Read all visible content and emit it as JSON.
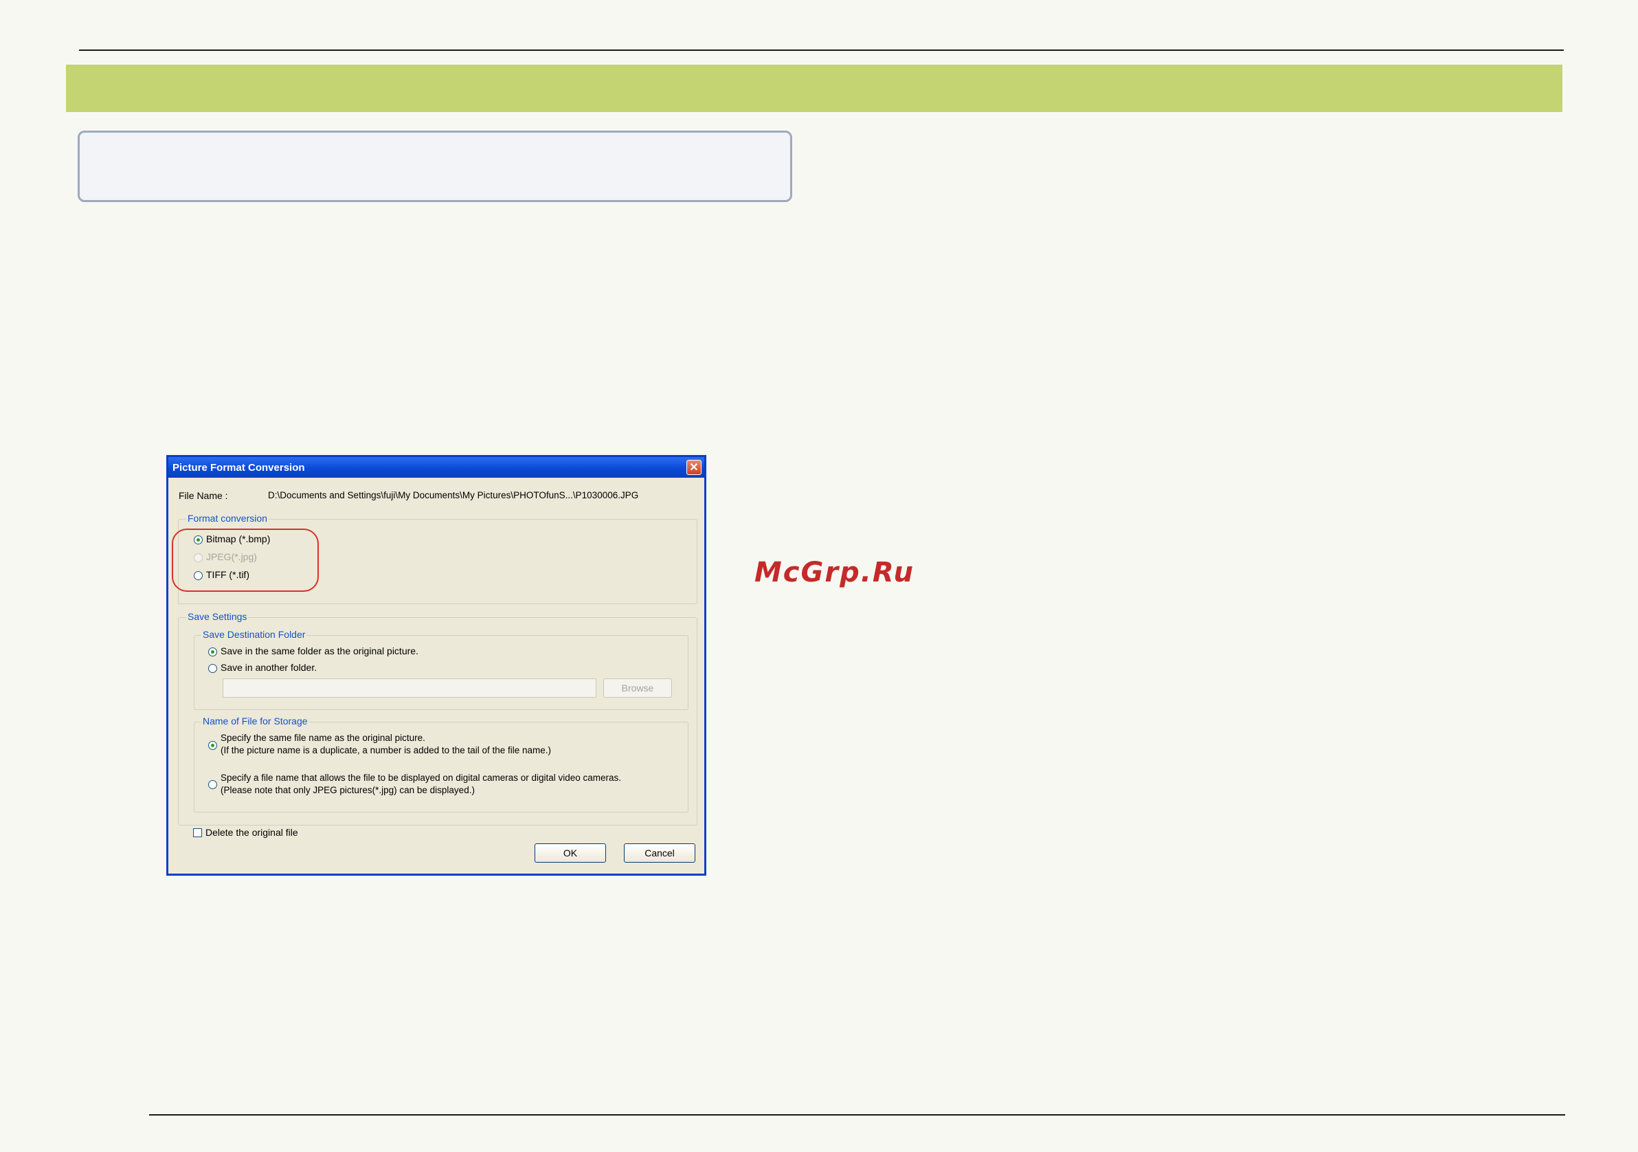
{
  "watermark": "McGrp.Ru",
  "dialog": {
    "title": "Picture Format Conversion",
    "close_icon": "close-icon",
    "file_name_label": "File Name :",
    "file_name_value": "D:\\Documents and Settings\\fuji\\My Documents\\My Pictures\\PHOTOfunS...\\P1030006.JPG",
    "format_group": {
      "title": "Format conversion",
      "options": [
        {
          "label": "Bitmap (*.bmp)",
          "selected": true,
          "enabled": true
        },
        {
          "label": "JPEG(*.jpg)",
          "selected": false,
          "enabled": false
        },
        {
          "label": "TIFF (*.tif)",
          "selected": false,
          "enabled": true
        }
      ]
    },
    "save_settings": {
      "title": "Save Settings",
      "destination": {
        "title": "Save Destination Folder",
        "same_folder": "Save in the same folder as the original picture.",
        "another_folder": "Save in another folder.",
        "folder_path": "",
        "browse_label": "Browse"
      },
      "file_name": {
        "title": "Name of File for Storage",
        "same_name_line1": "Specify the same file name as the original picture.",
        "same_name_line2": "(If the picture name is a duplicate, a number is added to the tail of the file name.)",
        "camera_name_line1": "Specify a file name that allows the file to be displayed on digital cameras or digital video cameras.",
        "camera_name_line2": "(Please note that only JPEG pictures(*.jpg) can be displayed.)"
      }
    },
    "delete_original": "Delete the original file",
    "ok_label": "OK",
    "cancel_label": "Cancel"
  }
}
